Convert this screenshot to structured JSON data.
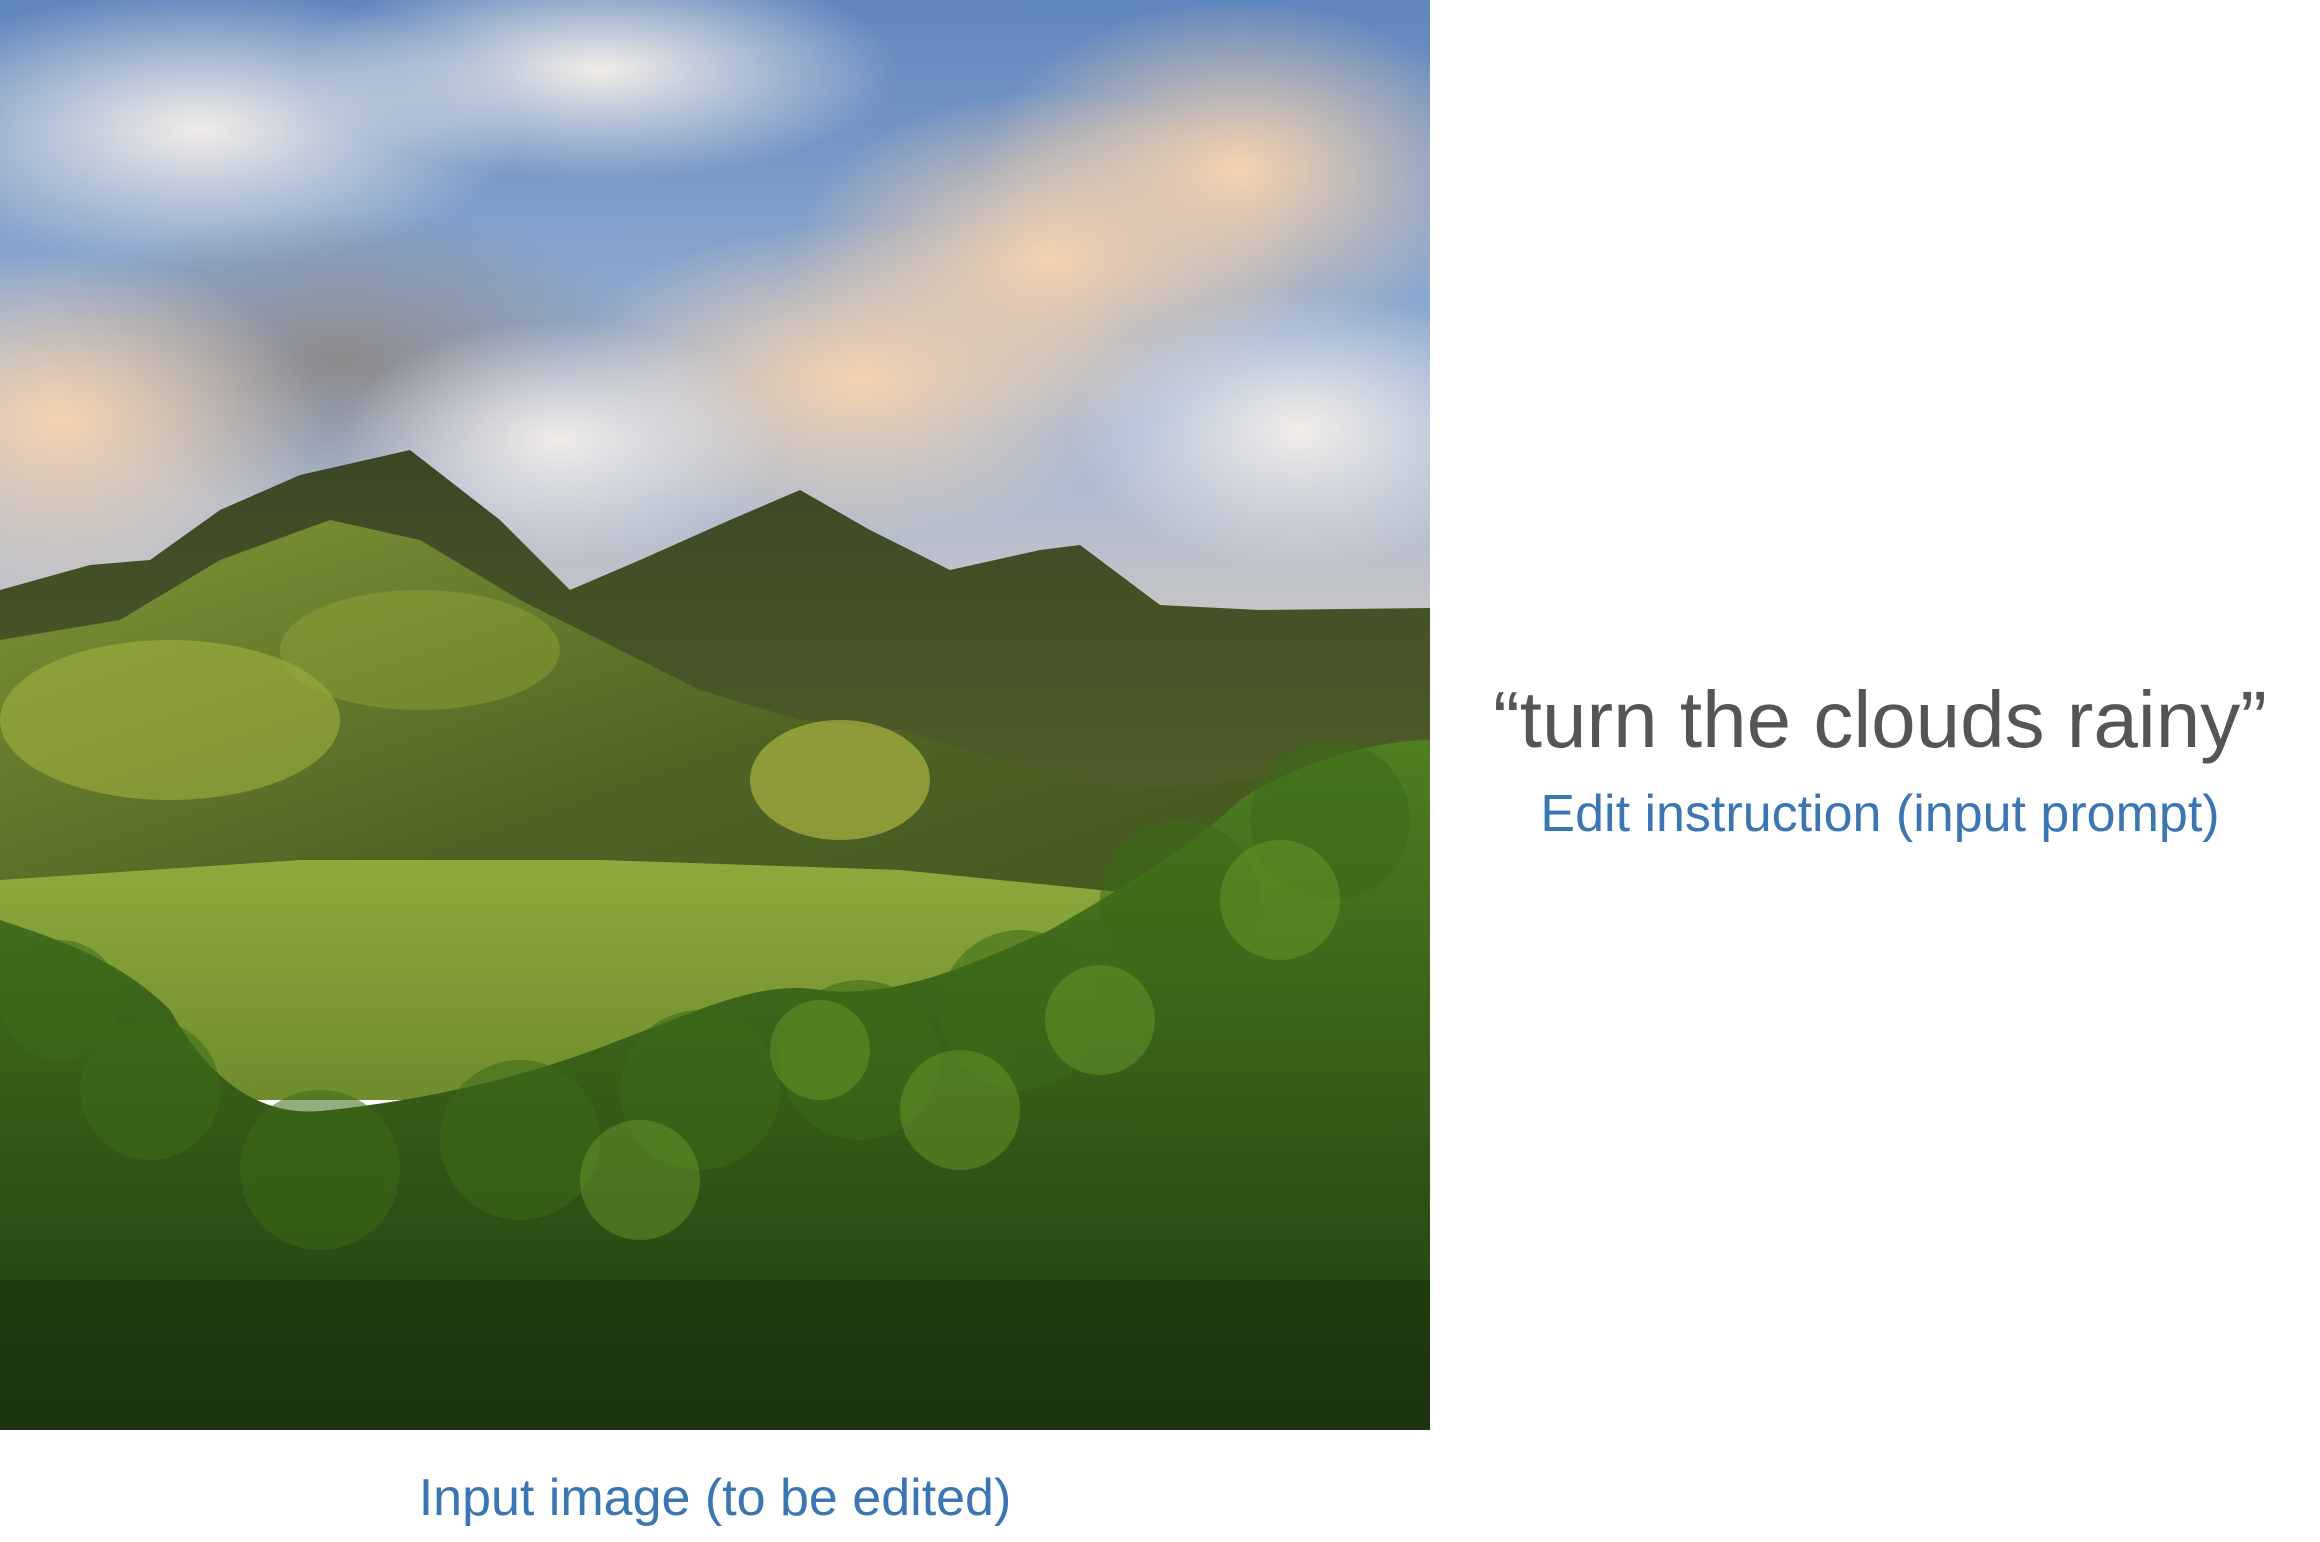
{
  "photo": {
    "description_icon": "landscape-photo",
    "colors": {
      "sky": "#6f93c6",
      "cloud": "#e8dcd0",
      "cloud_warm": "#f3c99f",
      "mountain_dark": "#3d4a22",
      "mountain_light": "#8aa23a",
      "forest": "#2f5a18"
    }
  },
  "prompt": {
    "text": "“turn the clouds rainy”",
    "caption": "Edit instruction (input prompt)"
  },
  "image_caption": "Input image (to be edited)",
  "colors": {
    "caption": "#3b76b4",
    "prompt": "#555555"
  }
}
